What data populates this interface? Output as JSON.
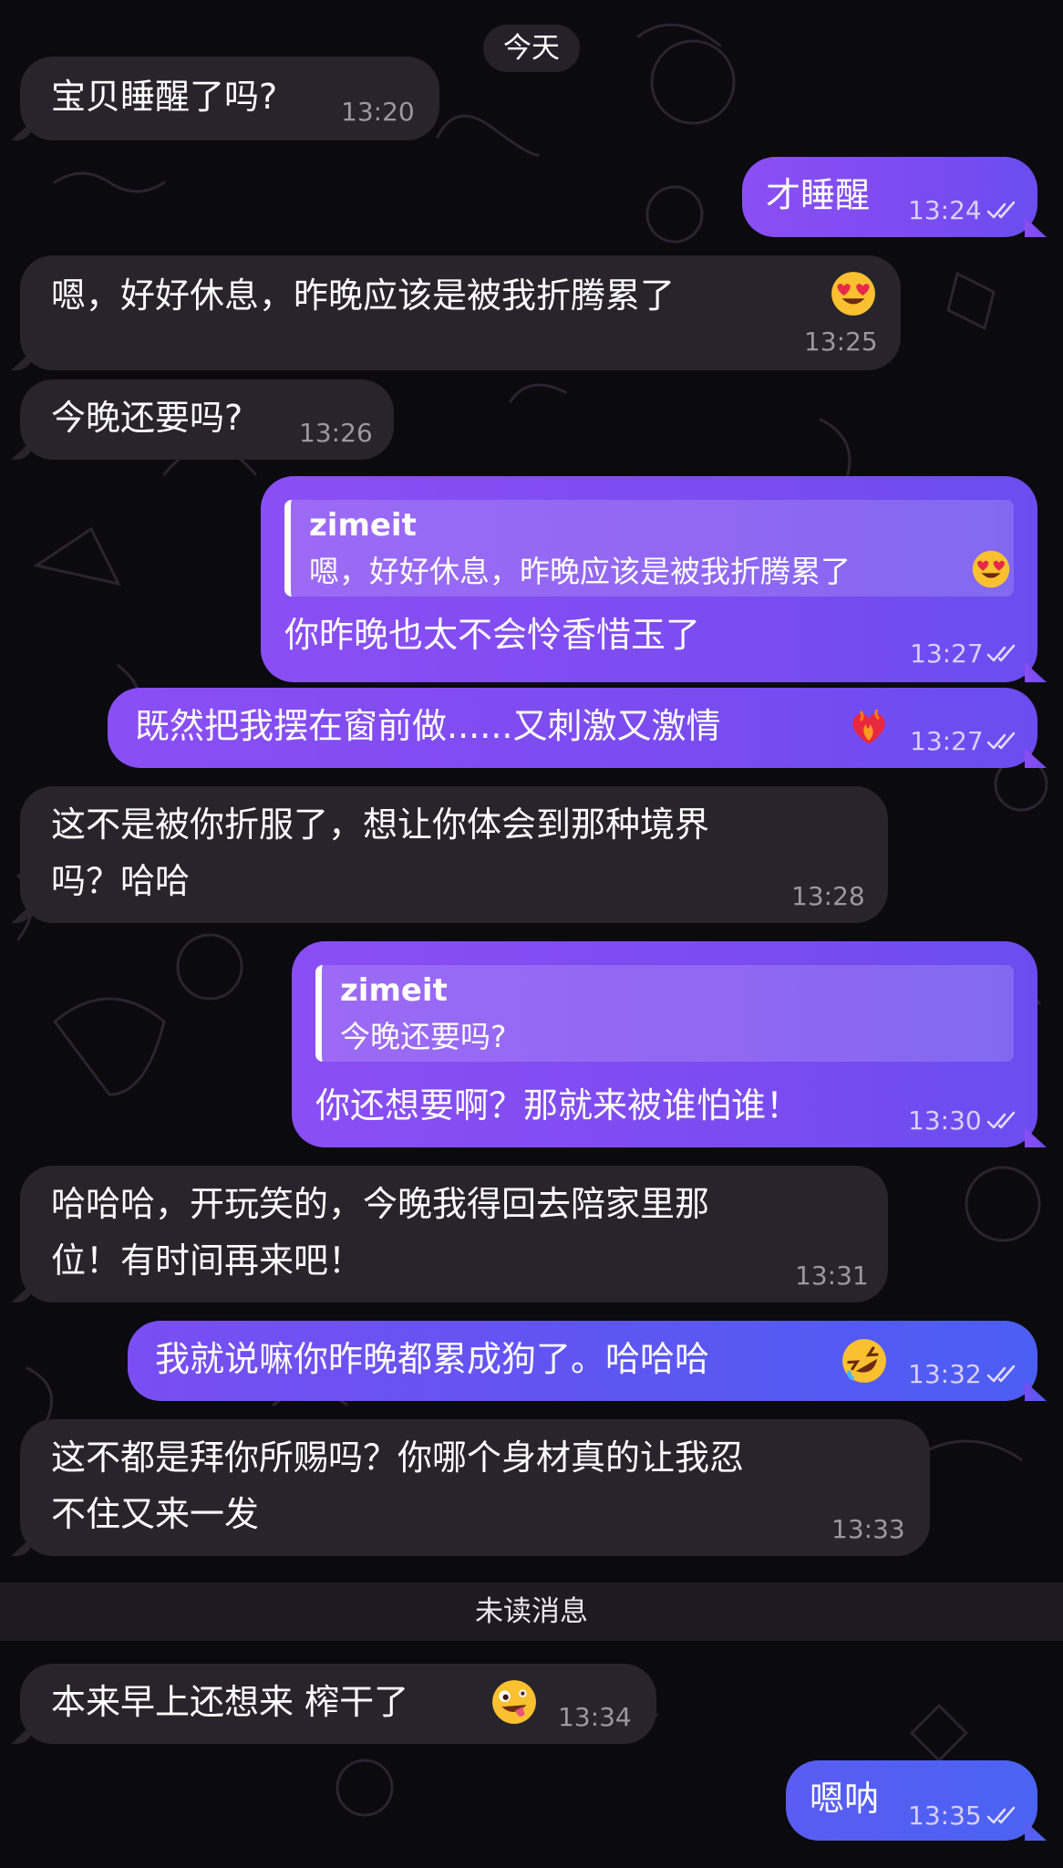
{
  "date_label": "今天",
  "unread_label": "未读消息",
  "messages": [
    {
      "text": "宝贝睡醒了吗?",
      "time": "13:20"
    },
    {
      "text": "才睡醒",
      "time": "13:24"
    },
    {
      "text": "嗯，好好休息，昨晚应该是被我折腾累了",
      "time": "13:25"
    },
    {
      "text": "今晚还要吗?",
      "time": "13:26"
    },
    {
      "reply_name": "zimeit",
      "reply_text": "嗯，好好休息，昨晚应该是被我折腾累了",
      "text": "你昨晚也太不会怜香惜玉了",
      "time": "13:27"
    },
    {
      "text": "既然把我摆在窗前做......又刺激又激情",
      "time": "13:27"
    },
    {
      "line1": "这不是被你折服了，想让你体会到那种境界",
      "line2": "吗？哈哈",
      "time": "13:28"
    },
    {
      "reply_name": "zimeit",
      "reply_text": "今晚还要吗?",
      "text": "你还想要啊？那就来被谁怕谁！",
      "time": "13:30"
    },
    {
      "line1": "哈哈哈，开玩笑的，今晚我得回去陪家里那",
      "line2": "位！有时间再来吧！",
      "time": "13:31"
    },
    {
      "text": "我就说嘛你昨晚都累成狗了。哈哈哈",
      "time": "13:32"
    },
    {
      "line1": "这不都是拜你所赐吗？你哪个身材真的让我忍",
      "line2": "不住又来一发",
      "time": "13:33"
    },
    {
      "text": "本来早上还想来 榨干了",
      "time": "13:34"
    },
    {
      "text": "嗯呐",
      "time": "13:35"
    }
  ],
  "colors": {
    "incoming_bubble": "#27242b",
    "outgoing_purple": "#7d4cf0",
    "outgoing_blue": "#4b5ef3",
    "background": "#0b0a0e"
  },
  "icons": [
    "double-check-icon",
    "heart-eyes-emoji-icon",
    "heart-on-fire-emoji-icon",
    "rolling-laughing-emoji-icon",
    "zany-face-emoji-icon"
  ]
}
